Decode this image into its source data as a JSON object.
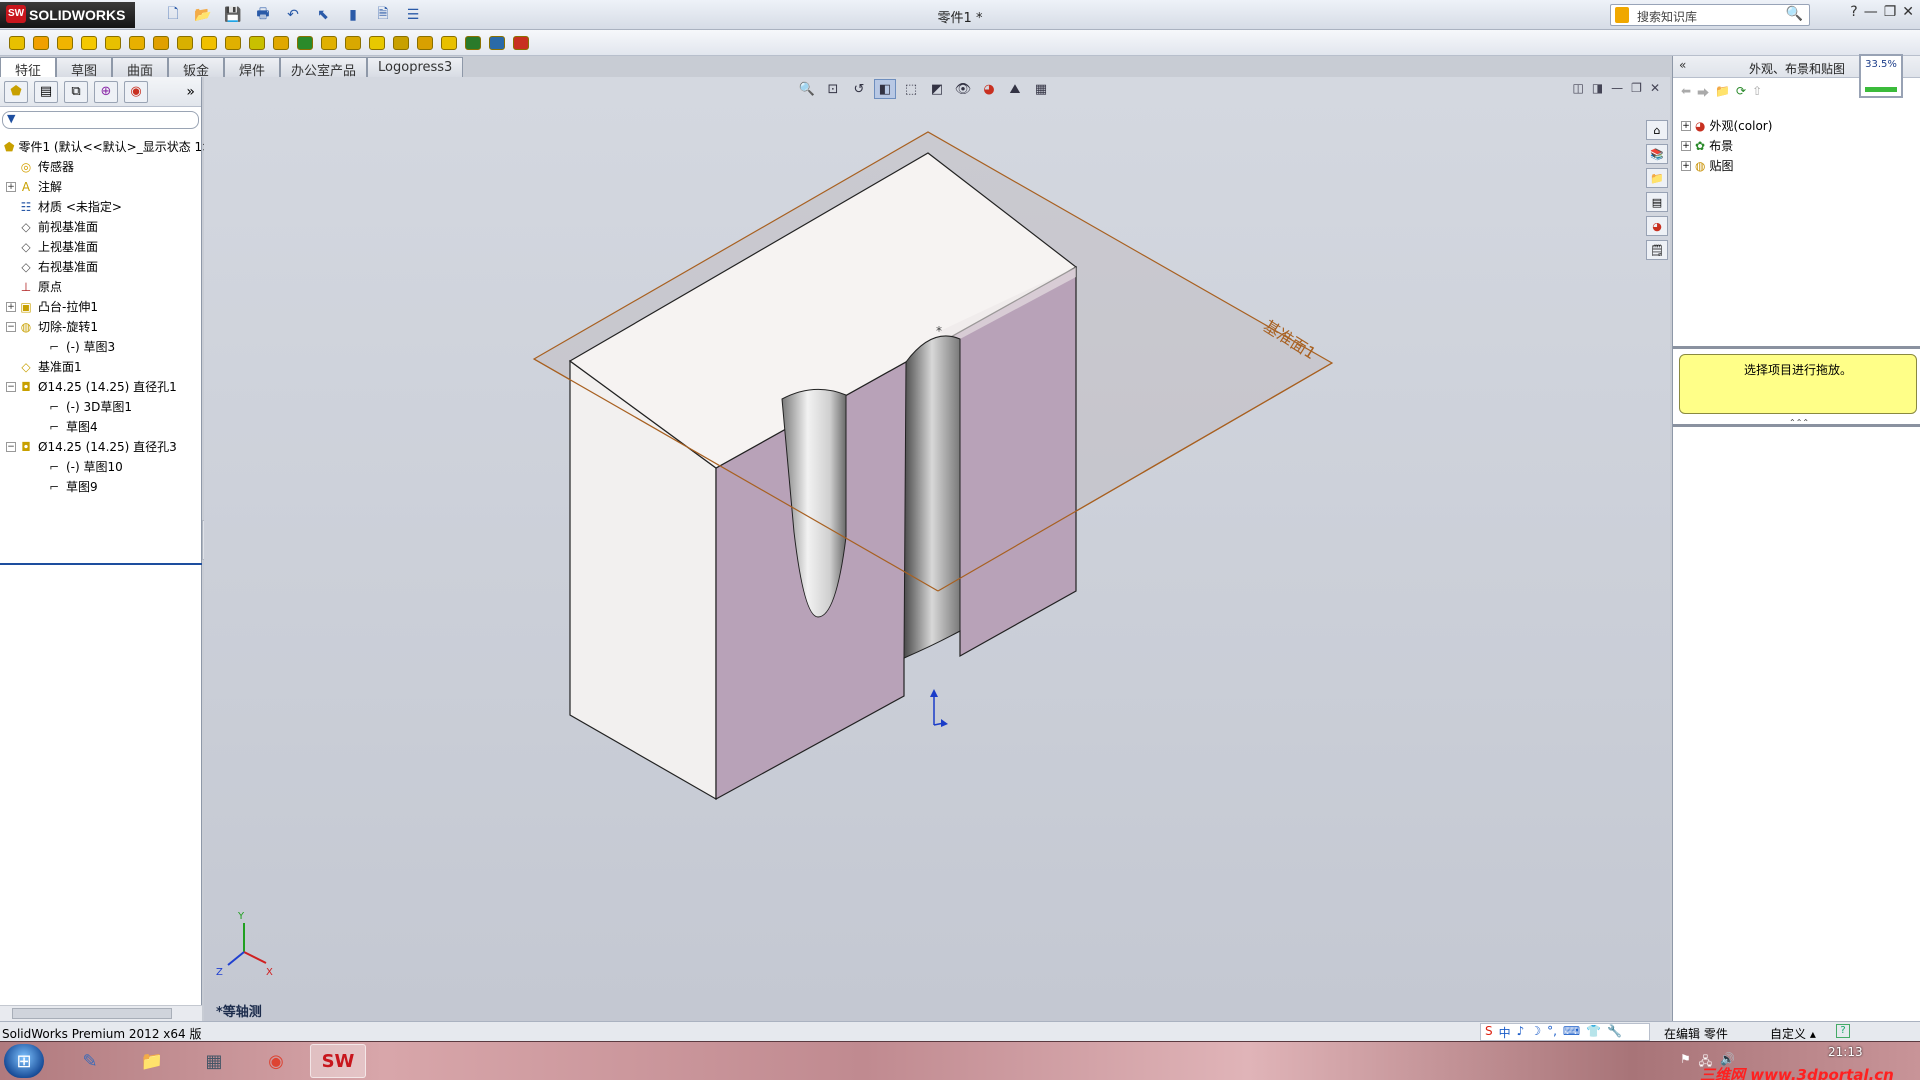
{
  "titlebar": {
    "brand": "SOLIDWORKS",
    "brand_badge": "SW",
    "document_title": "零件1 *",
    "search_placeholder": "搜索知识库",
    "help_label": "?",
    "minimize_glyph": "—",
    "restore_glyph": "❐",
    "close_glyph": "✕"
  },
  "ribbon_tabs": [
    {
      "label": "特征",
      "active": true
    },
    {
      "label": "草图",
      "active": false
    },
    {
      "label": "曲面",
      "active": false
    },
    {
      "label": "钣金",
      "active": false
    },
    {
      "label": "焊件",
      "active": false
    },
    {
      "label": "办公室产品",
      "active": false
    },
    {
      "label": "Logopress3",
      "active": false
    }
  ],
  "feature_tree": {
    "collapse_glyph": "»",
    "filter_glyph": "▼",
    "nodes": [
      {
        "label": "零件1 (默认<<默认>_显示状态 1>)",
        "indent": 0,
        "expander": "",
        "icon": "part-icon",
        "color": "#c8a000"
      },
      {
        "label": "传感器",
        "indent": 1,
        "expander": "",
        "icon": "sensor-icon",
        "color": "#d4a000"
      },
      {
        "label": "注解",
        "indent": 1,
        "expander": "+",
        "icon": "annotation-icon",
        "color": "#c8a000"
      },
      {
        "label": "材质 <未指定>",
        "indent": 1,
        "expander": "",
        "icon": "material-icon",
        "color": "#2a5aa8"
      },
      {
        "label": "前视基准面",
        "indent": 1,
        "expander": "",
        "icon": "plane-icon",
        "color": "#555555"
      },
      {
        "label": "上视基准面",
        "indent": 1,
        "expander": "",
        "icon": "plane-icon",
        "color": "#555555"
      },
      {
        "label": "右视基准面",
        "indent": 1,
        "expander": "",
        "icon": "plane-icon",
        "color": "#555555"
      },
      {
        "label": "原点",
        "indent": 1,
        "expander": "",
        "icon": "origin-icon",
        "color": "#b02020"
      },
      {
        "label": "凸台-拉伸1",
        "indent": 1,
        "expander": "+",
        "icon": "extrude-icon",
        "color": "#c8a000"
      },
      {
        "label": "切除-旋转1",
        "indent": 1,
        "expander": "−",
        "icon": "revolve-cut-icon",
        "color": "#c8a000"
      },
      {
        "label": "(-) 草图3",
        "indent": 2,
        "expander": "",
        "icon": "sketch-icon",
        "color": "#333333"
      },
      {
        "label": "基准面1",
        "indent": 1,
        "expander": "",
        "icon": "plane-icon",
        "color": "#c8a000"
      },
      {
        "label": "Ø14.25 (14.25) 直径孔1",
        "indent": 1,
        "expander": "−",
        "icon": "hole-icon",
        "color": "#c8a000"
      },
      {
        "label": "(-) 3D草图1",
        "indent": 2,
        "expander": "",
        "icon": "sketch3d-icon",
        "color": "#333333"
      },
      {
        "label": "草图4",
        "indent": 2,
        "expander": "",
        "icon": "sketch-icon",
        "color": "#333333"
      },
      {
        "label": "Ø14.25 (14.25) 直径孔3",
        "indent": 1,
        "expander": "−",
        "icon": "hole-icon",
        "color": "#c8a000"
      },
      {
        "label": "(-) 草图10",
        "indent": 2,
        "expander": "",
        "icon": "sketch-icon",
        "color": "#333333"
      },
      {
        "label": "草图9",
        "indent": 2,
        "expander": "",
        "icon": "sketch-icon",
        "color": "#333333"
      }
    ]
  },
  "viewport": {
    "plane_label": "基准面1",
    "view_orientation": "*等轴测",
    "triad": {
      "x": "X",
      "y": "Y",
      "z": "Z"
    },
    "colors": {
      "top_face": "#f6f3f2",
      "left_face": "#f2f0ef",
      "cut_face": "#b8a2b8",
      "plane_edge": "#a86020",
      "background_top": "#d4d8e0"
    }
  },
  "task_pane": {
    "back_glyph": "«",
    "title": "外观、布景和贴图",
    "zoom": "33.5%",
    "items": [
      {
        "label": "外观(color)",
        "icon": "appearance-icon"
      },
      {
        "label": "布景",
        "icon": "scene-icon"
      },
      {
        "label": "贴图",
        "icon": "decal-icon"
      }
    ],
    "hint": "选择项目进行拖放。",
    "splitter_glyph": "⌃⌃⌃"
  },
  "statusbar": {
    "product": "SolidWorks Premium 2012 x64 版",
    "ime_items": [
      "S",
      "中",
      "♪",
      "☽",
      "°,",
      "⌨",
      "👕",
      "🔧"
    ],
    "editing": "在编辑 零件",
    "custom": "自定义 ▴",
    "help": "?"
  },
  "taskbar": {
    "start_glyph": "⊞",
    "time": "21:13",
    "watermark": "三维网 www.3dportal.cn"
  }
}
